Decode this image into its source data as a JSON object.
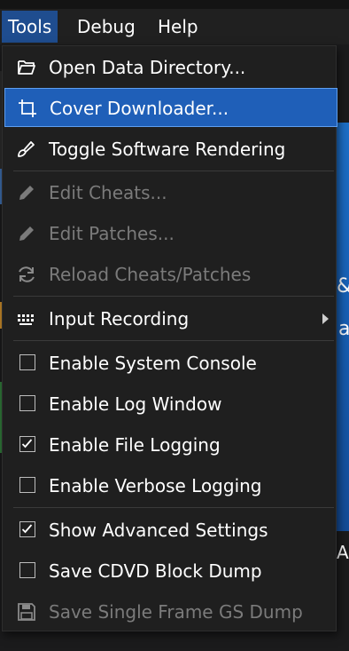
{
  "menubar": {
    "items": [
      {
        "label": "Tools"
      },
      {
        "label": "Debug"
      },
      {
        "label": "Help"
      }
    ]
  },
  "background": {
    "text1": "&",
    "text2": "a",
    "text3": "A"
  },
  "menu": {
    "items": [
      {
        "label": "Open Data Directory...",
        "icon": "folder-open-icon",
        "enabled": true
      },
      {
        "label": "Cover Downloader...",
        "icon": "crop-icon",
        "enabled": true,
        "highlighted": true
      },
      {
        "label": "Toggle Software Rendering",
        "icon": "brush-icon",
        "enabled": true
      },
      {
        "label": "Edit Cheats...",
        "icon": "pencil-icon",
        "enabled": false
      },
      {
        "label": "Edit Patches...",
        "icon": "pencil-icon",
        "enabled": false
      },
      {
        "label": "Reload Cheats/Patches",
        "icon": "refresh-icon",
        "enabled": false
      },
      {
        "label": "Input Recording",
        "icon": "keyboard-icon",
        "enabled": true,
        "submenu": true
      },
      {
        "label": "Enable System Console",
        "checked": false,
        "enabled": true
      },
      {
        "label": "Enable Log Window",
        "checked": false,
        "enabled": true
      },
      {
        "label": "Enable File Logging",
        "checked": true,
        "enabled": true
      },
      {
        "label": "Enable Verbose Logging",
        "checked": false,
        "enabled": true
      },
      {
        "label": "Show Advanced Settings",
        "checked": true,
        "enabled": true
      },
      {
        "label": "Save CDVD Block Dump",
        "checked": false,
        "enabled": true
      },
      {
        "label": "Save Single Frame GS Dump",
        "icon": "save-icon",
        "enabled": false
      }
    ]
  },
  "colors": {
    "accent": "#1f5fb8",
    "menu_bg": "#1f1f1f",
    "disabled_text": "#7b7b7b"
  }
}
